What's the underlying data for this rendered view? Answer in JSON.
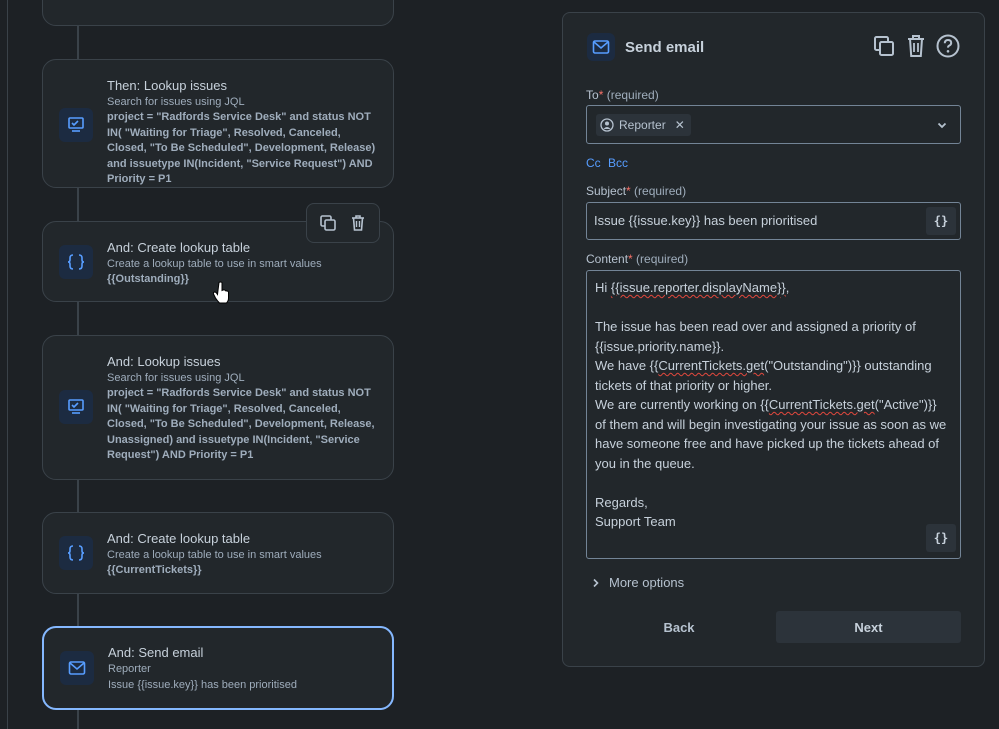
{
  "flow": {
    "cards": [
      {
        "title": "Then: Lookup issues",
        "subtitle": "Search for issues using JQL",
        "detail": "project = \"Radfords Service Desk\" and status NOT IN( \"Waiting for Triage\", Resolved, Canceled, Closed, \"To Be Scheduled\", Development, Release) and issuetype IN(Incident, \"Service Request\") AND Priority = P1",
        "icon": "issues-search-icon"
      },
      {
        "title": "And: Create lookup table",
        "subtitle": "Create a lookup table to use in smart values",
        "detail": "{{Outstanding}}",
        "icon": "curly-braces-icon"
      },
      {
        "title": "And: Lookup issues",
        "subtitle": "Search for issues using JQL",
        "detail": "project = \"Radfords Service Desk\" and status NOT IN( \"Waiting for Triage\", Resolved, Canceled, Closed, \"To Be Scheduled\", Development, Release, Unassigned) and issuetype IN(Incident, \"Service Request\") AND Priority = P1",
        "icon": "issues-search-icon"
      },
      {
        "title": "And: Create lookup table",
        "subtitle": "Create a lookup table to use in smart values",
        "detail": "{{CurrentTickets}}",
        "icon": "curly-braces-icon"
      },
      {
        "title": "And: Send email",
        "subtitle": "Reporter",
        "detail": "Issue {{issue.key}} has been prioritised",
        "icon": "mail-icon"
      }
    ]
  },
  "panel": {
    "title": "Send email",
    "to": {
      "label": "To",
      "required_star": "*",
      "required_text": "(required)",
      "chip": "Reporter"
    },
    "cc_label": "Cc",
    "bcc_label": "Bcc",
    "subject": {
      "label": "Subject",
      "required_star": "*",
      "required_text": "(required)",
      "value": "Issue {{issue.key}} has been prioritised"
    },
    "content": {
      "label": "Content",
      "required_star": "*",
      "required_text": "(required)",
      "line1_pre": "Hi ",
      "line1_squiggle": "{{issue.reporter.displayName}}",
      "line1_post": ",",
      "line2": "The issue has been read over and assigned a priority of {{issue.priority.name}}.",
      "line3_pre": "We have {{",
      "line3_squiggle": "CurrentTickets.get",
      "line3_post": "(\"Outstanding\")}} outstanding tickets of that priority or higher.",
      "line4_pre": "We are currently working on {{",
      "line4_squiggle": "CurrentTickets.get",
      "line4_post": "(\"Active\")}} of them and will begin investigating your issue as soon as we have someone free and have picked up the tickets ahead of you in the queue.",
      "line5": "Regards,",
      "line6": "Support Team"
    },
    "smart_value_button": "{}",
    "more_options": "More options",
    "back_label": "Back",
    "next_label": "Next"
  }
}
